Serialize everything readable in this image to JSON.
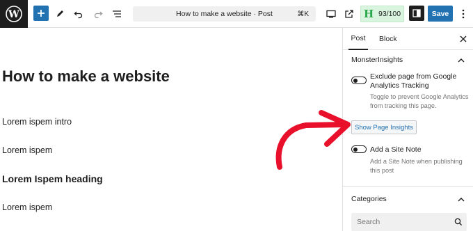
{
  "toolbar": {
    "wp_logo": "wordpress-logo",
    "add_icon": "plus-icon",
    "tools_icon": "pencil-icon",
    "undo_icon": "undo-icon",
    "redo_icon": "redo-icon",
    "list_view_icon": "list-view-icon",
    "document_title": "How to make a website · Post",
    "shortcut": "⌘K",
    "view_icon": "desktop-icon",
    "preview_icon": "external-link-icon",
    "score": "93/100",
    "score_logo": "H",
    "settings_icon": "sidebar-icon",
    "save_label": "Save",
    "options_icon": "more-vertical-icon"
  },
  "editor": {
    "title": "How to make a website",
    "paragraphs": [
      "Lorem ispem intro",
      "Lorem ispem",
      "Lorem Ispem heading",
      "Lorem ispem"
    ]
  },
  "sidebar": {
    "tabs": [
      "Post",
      "Block"
    ],
    "active_tab": "Post",
    "monsterinsights": {
      "title": "MonsterInsights",
      "exclude_label": "Exclude page from Google Analytics Tracking",
      "exclude_help": "Toggle to prevent Google Analytics from tracking this page.",
      "insights_button": "Show Page Insights",
      "site_note_label": "Add a Site Note",
      "site_note_help": "Add a Site Note when publishing this post"
    },
    "categories": {
      "title": "Categories",
      "search_placeholder": "Search"
    }
  },
  "colors": {
    "accent": "#2271b1",
    "annotation_arrow": "#e8102a",
    "score_bg": "#d9f4df"
  }
}
